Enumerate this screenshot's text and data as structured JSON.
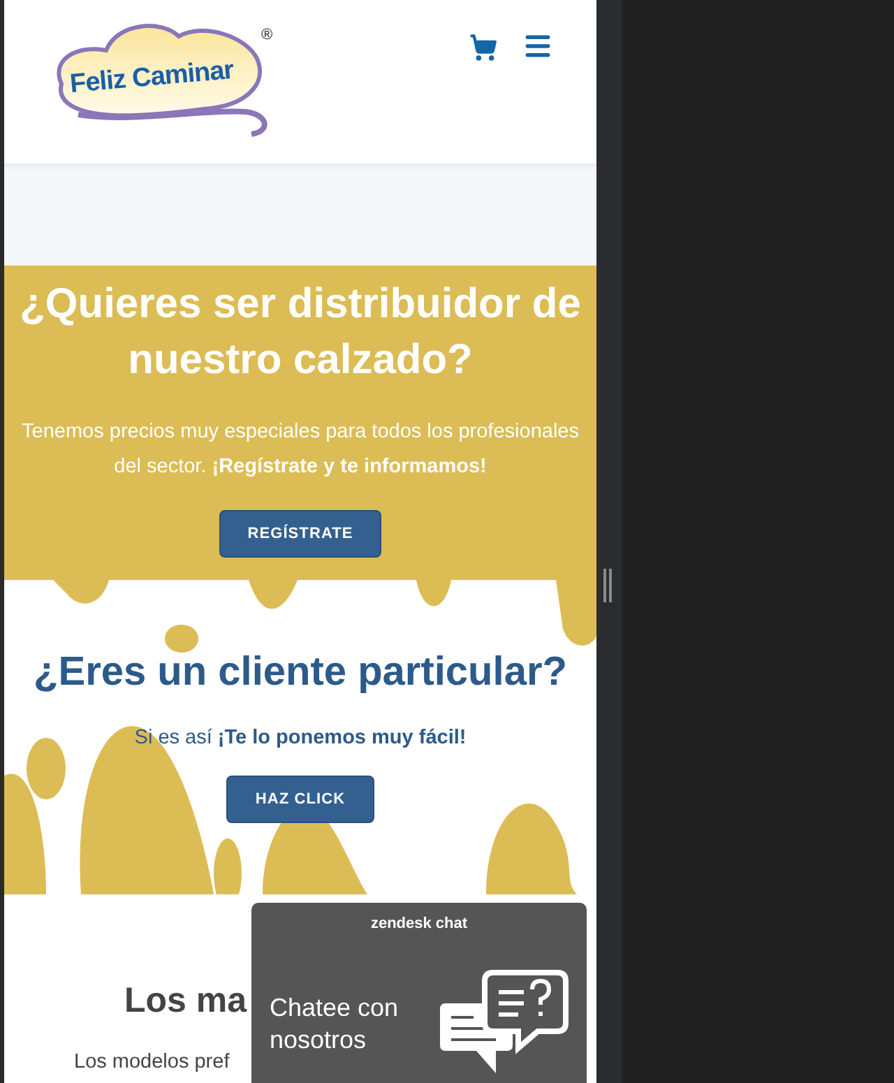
{
  "header": {
    "logo": {
      "text": "Feliz Caminar",
      "mark": "®"
    }
  },
  "distributor": {
    "title": "¿Quieres ser distribuidor de nuestro calzado?",
    "text": "Tenemos precios muy especiales para todos los profesionales del sector. **¡Regístrate y te informamos!**",
    "button": "REGÍSTRATE"
  },
  "customer": {
    "title": "¿Eres un cliente particular?",
    "text": "Si es así **¡Te lo ponemos muy fácil!**",
    "button": "HAZ CLICK"
  },
  "models": {
    "title": "Los ma",
    "text": "Los modelos pref"
  },
  "chat": {
    "brand": "zendesk chat",
    "label": "Chatee con nosotros"
  }
}
